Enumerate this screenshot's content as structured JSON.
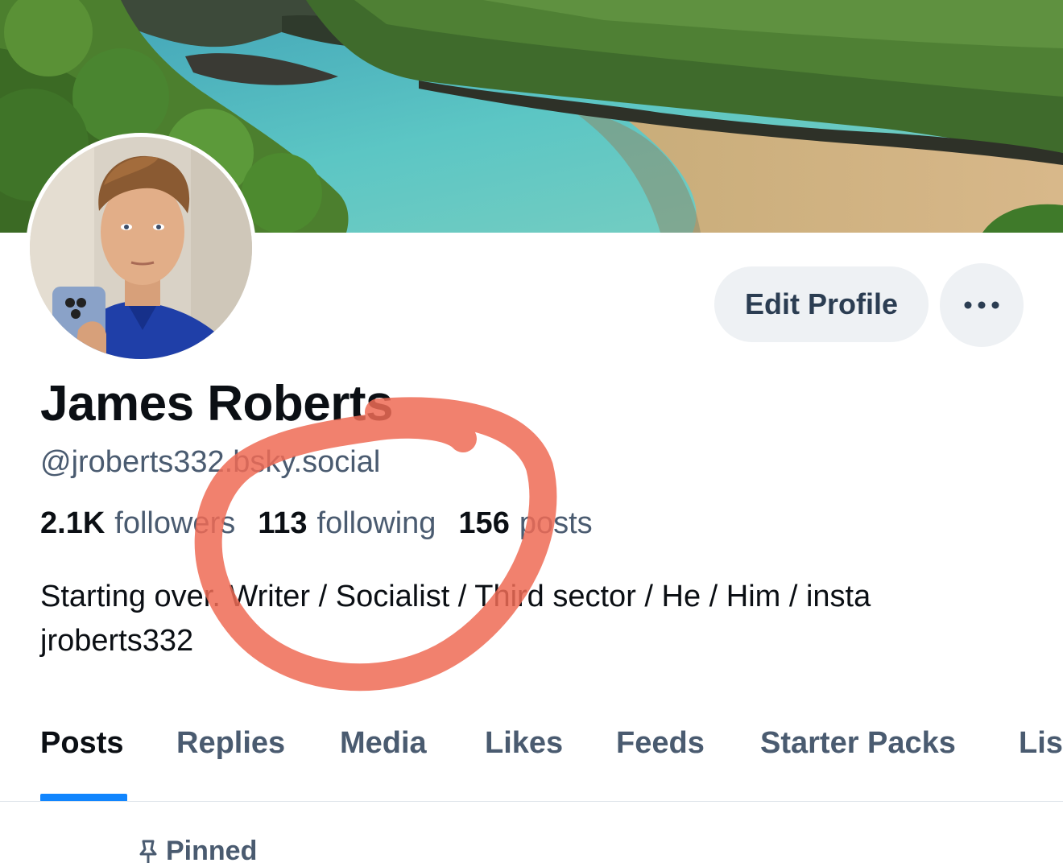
{
  "profile": {
    "display_name": "James Roberts",
    "handle": "@jroberts332.bsky.social",
    "bio": "Starting over. Writer / Socialist / Third sector / He / Him / insta jroberts332"
  },
  "stats": {
    "followers_count": "2.1K",
    "followers_label": "followers",
    "following_count": "113",
    "following_label": "following",
    "posts_count": "156",
    "posts_label": "posts"
  },
  "actions": {
    "edit_profile_label": "Edit Profile",
    "more_icon": "ellipsis-icon"
  },
  "tabs": [
    {
      "label": "Posts",
      "active": true
    },
    {
      "label": "Replies",
      "active": false
    },
    {
      "label": "Media",
      "active": false
    },
    {
      "label": "Likes",
      "active": false
    },
    {
      "label": "Feeds",
      "active": false
    },
    {
      "label": "Starter Packs",
      "active": false
    },
    {
      "label": "Lists",
      "active": false
    }
  ],
  "feed": {
    "pinned_label": "Pinned",
    "pinned_icon": "pin-icon"
  },
  "colors": {
    "accent": "#1185fe",
    "annotation": "#ee6b55",
    "text_muted": "#4a5b70",
    "button_bg": "#eef1f4"
  }
}
